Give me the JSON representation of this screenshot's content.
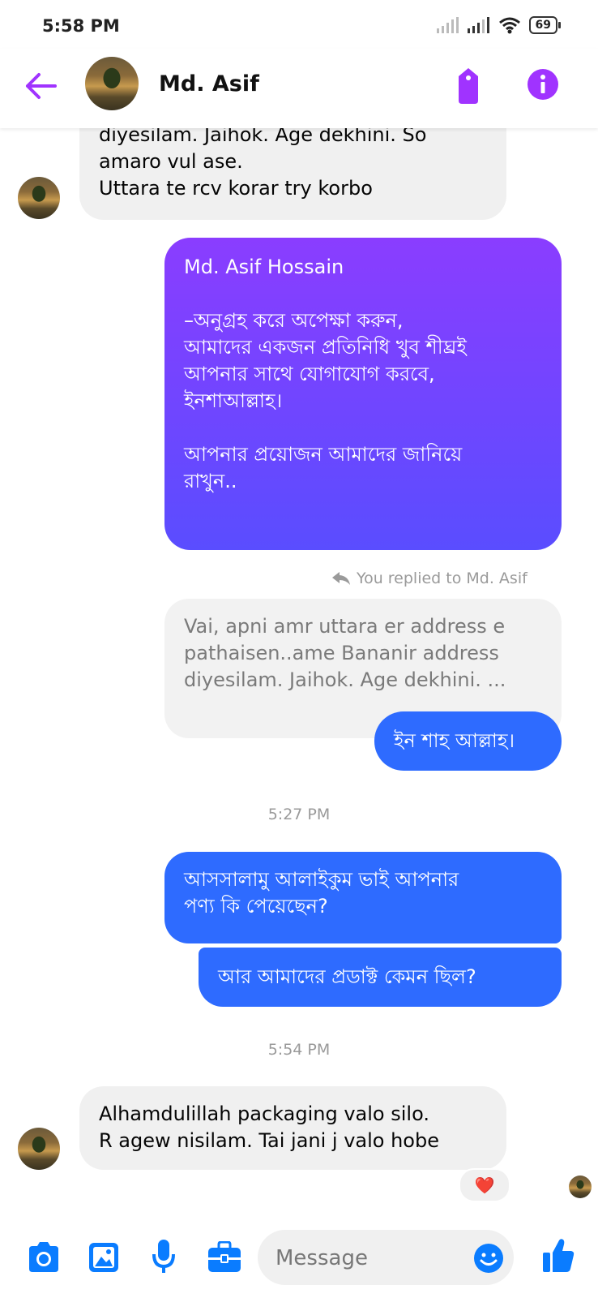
{
  "status_bar": {
    "time": "5:58 PM",
    "battery": "69"
  },
  "header": {
    "contact_name": "Md. Asif"
  },
  "messages": {
    "m1_lines": [
      "diyesilam. Jaihok. Age dekhini. So",
      "amaro vul ase.",
      "Uttara te rcv korar try korbo"
    ],
    "m2_lines": [
      "Md. Asif Hossain",
      "",
      "–অনুগ্রহ করে অপেক্ষা করুন,",
      "আমাদের একজন প্রতিনিধি খুব শীঘ্রই",
      "আপনার সাথে যোগাযোগ করবে,",
      "ইনশাআল্লাহ।",
      "",
      "আপনার প্রয়োজন আমাদের জানিয়ে",
      "রাখুন.."
    ],
    "reply_label": "You replied to Md. Asif",
    "quoted_lines": [
      "Vai, apni amr uttara er address e",
      "pathaisen..ame Bananir address",
      "diyesilam. Jaihok. Age dekhini. ..."
    ],
    "m3": "ইন শাহ আল্লাহ।",
    "time1": "5:27 PM",
    "m4_lines": [
      "আসসালামু আলাইকুম ভাই আপনার",
      "পণ্য কি পেয়েছেন?"
    ],
    "m5": "আর আমাদের প্রডাক্ট কেমন ছিল?",
    "time2": "5:54 PM",
    "m6_lines": [
      "Alhamdulillah packaging  valo silo.",
      "R agew nisilam. Tai jani j valo hobe"
    ],
    "reaction": "❤️"
  },
  "composer": {
    "placeholder": "Message"
  },
  "colors": {
    "accent": "#a033ff",
    "sent_blue": "#2e6bff",
    "gradient_top": "#8a3dff",
    "gradient_bottom": "#5a4dff",
    "icon_blue": "#0a7cff"
  }
}
